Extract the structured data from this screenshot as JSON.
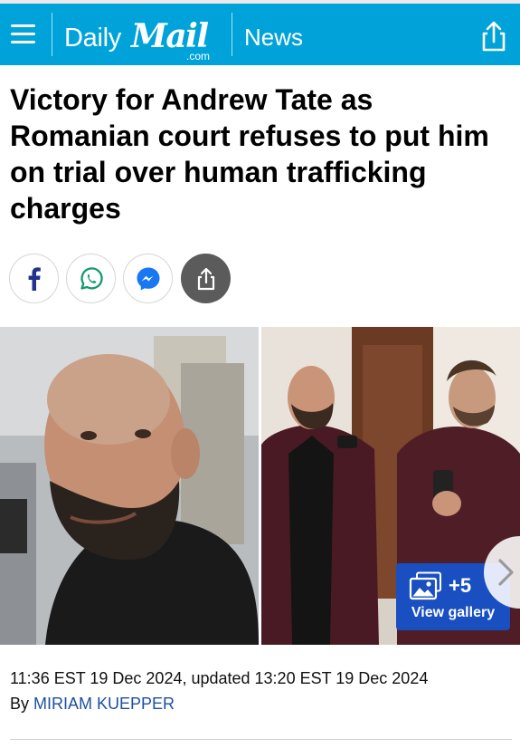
{
  "header": {
    "brand_daily": "Daily",
    "brand_mail": "Mail",
    "brand_tld": ".com",
    "section": "News",
    "background_color": "#00a3d9"
  },
  "article": {
    "headline": "Victory for Andrew Tate as Romanian court refuses to put him on trial over human trafficking charges",
    "timestamp": "11:36 EST 19 Dec 2024, updated 13:20 EST 19 Dec 2024",
    "byline_prefix": "By",
    "author": "MIRIAM KUEPPER"
  },
  "share_buttons": [
    {
      "icon": "facebook-icon"
    },
    {
      "icon": "whatsapp-icon"
    },
    {
      "icon": "messenger-icon"
    },
    {
      "icon": "share-icon"
    }
  ],
  "gallery": {
    "count": "+5",
    "label": "View gallery",
    "button_color": "#1a4fc2"
  }
}
